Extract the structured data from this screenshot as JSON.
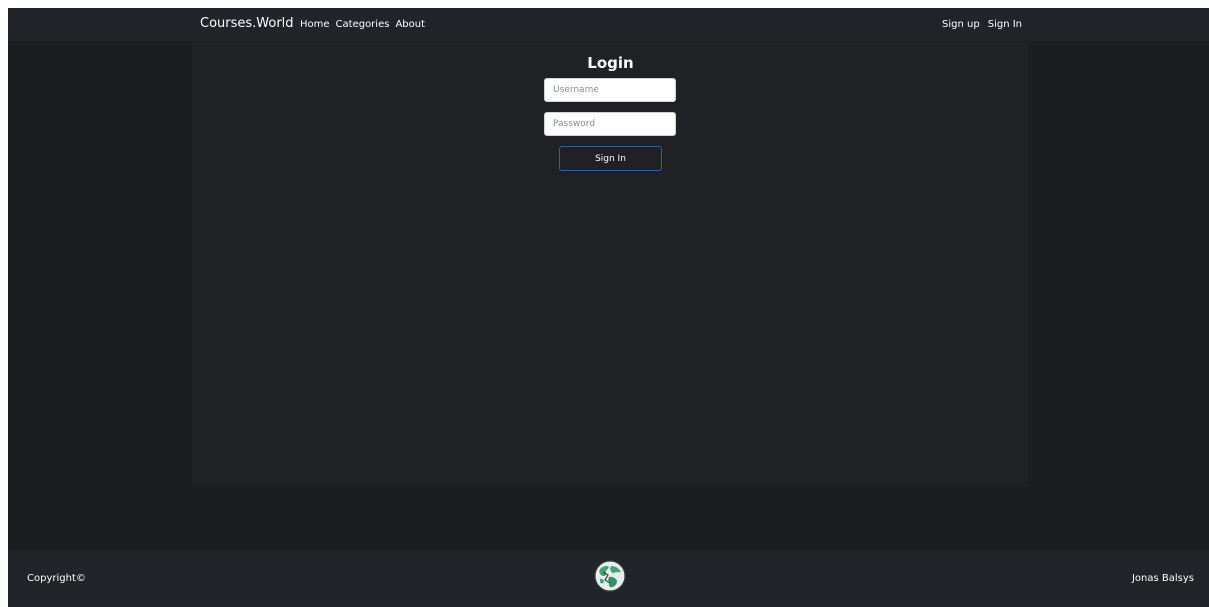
{
  "navbar": {
    "brand": "Courses.World",
    "links": [
      "Home",
      "Categories",
      "About"
    ],
    "auth": {
      "signup": "Sign up",
      "signin": "Sign In"
    }
  },
  "login": {
    "title": "Login",
    "username_placeholder": "Username",
    "password_placeholder": "Password",
    "submit_label": "Sign In",
    "submit_border_color": "#2f5fa8"
  },
  "footer": {
    "copyright": "Copyright©",
    "author": "Jonas Balsys",
    "logo_icon": "globe-icon"
  },
  "colors": {
    "background": "#1c1d1f",
    "navbar": "#212429",
    "container": "#202124"
  }
}
